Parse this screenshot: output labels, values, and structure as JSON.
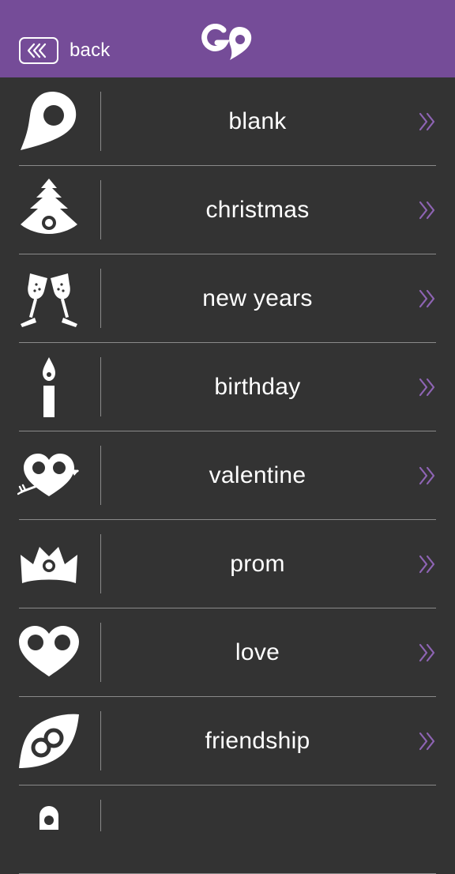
{
  "header": {
    "back_label": "back",
    "logo_text": "GO",
    "background": "#754c98"
  },
  "list": {
    "items": [
      {
        "label": "blank",
        "icon": "map-pin-icon"
      },
      {
        "label": "christmas",
        "icon": "christmas-tree-icon"
      },
      {
        "label": "new years",
        "icon": "champagne-glasses-icon"
      },
      {
        "label": "birthday",
        "icon": "candle-icon"
      },
      {
        "label": "valentine",
        "icon": "heart-arrow-icon"
      },
      {
        "label": "prom",
        "icon": "crown-icon"
      },
      {
        "label": "love",
        "icon": "heart-icon"
      },
      {
        "label": "friendship",
        "icon": "linked-rings-icon"
      },
      {
        "label": "",
        "icon": "map-pin-icon"
      }
    ],
    "chevron_color": "#8e64b4",
    "background": "#333333"
  }
}
